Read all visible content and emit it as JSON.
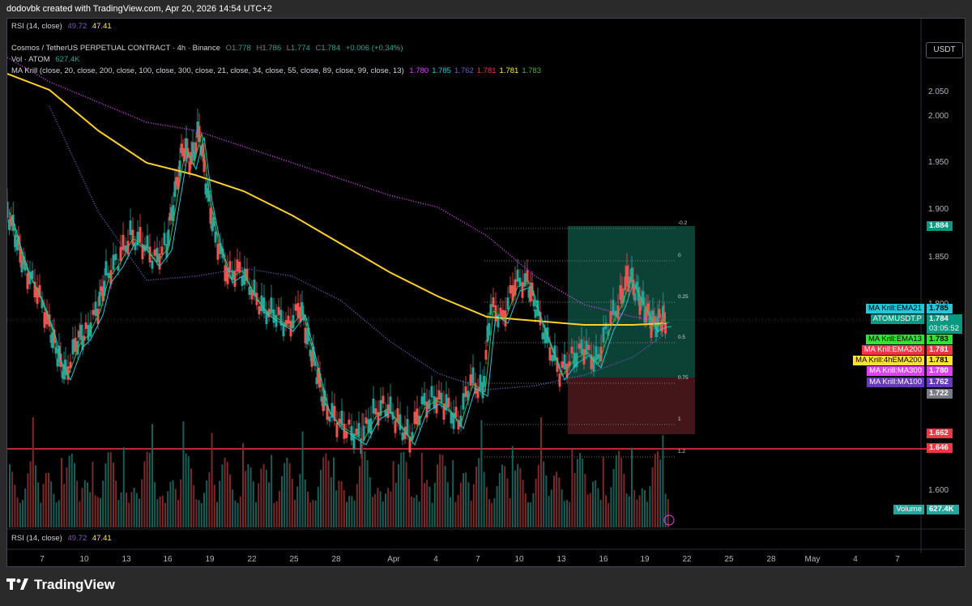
{
  "header": {
    "credit": "dodovbk created with TradingView.com, Apr 20, 2026 14:54 UTC+2"
  },
  "rsi_top": {
    "label": "RSI (14, close)",
    "v1": "49.72",
    "v2": "47.41"
  },
  "rsi_bottom": {
    "label": "RSI (14, close)",
    "v1": "49.72",
    "v2": "47.41"
  },
  "symbol": {
    "name": "Cosmos / TetherUS PERPETUAL CONTRACT · 4h · Binance",
    "o_label": "O",
    "o": "1.778",
    "h_label": "H",
    "h": "1.786",
    "l_label": "L",
    "l": "1.774",
    "c_label": "C",
    "c": "1.784",
    "change": "+0.006 (+0.34%)"
  },
  "volume_legend": {
    "label": "Vol · ATOM",
    "value": "627.4K"
  },
  "ma_legend": {
    "label": "MA Krill (close, 20, close, 200, close, 100, close, 300, close, 21, close, 34, close, 55, close, 89, close, 99, close, 13)",
    "values": [
      "1.780",
      "1.785",
      "1.762",
      "1.781",
      "1.781",
      "1.783"
    ],
    "colors": [
      "#e040fb",
      "#26c6da",
      "#7e57c2",
      "#f23645",
      "#ffeb3b",
      "#4caf50"
    ]
  },
  "currency_button": "USDT",
  "price_axis": [
    "2.050",
    "2.000",
    "1.950",
    "1.900",
    "1.850",
    "1.800",
    "1.600"
  ],
  "time_axis": [
    "7",
    "10",
    "13",
    "16",
    "19",
    "22",
    "25",
    "28",
    "Apr",
    "4",
    "7",
    "10",
    "13",
    "16",
    "19",
    "22",
    "25",
    "28",
    "May",
    "4",
    "7"
  ],
  "right_tags": [
    {
      "name": "MA Krill:EMA21",
      "value": "1.785",
      "bg": "#26c6da"
    },
    {
      "name": "ATOMUSDT.P",
      "value": "1.784",
      "sub": "03:05:52",
      "bg": "#089981"
    },
    {
      "name": "MA Krill:EMA13",
      "value": "1.783",
      "bg": "#2fe62f"
    },
    {
      "name": "MA Krill:EMA200",
      "value": "1.781",
      "bg": "#f23645"
    },
    {
      "name": "MA Krill:4hEMA200",
      "value": "1.781",
      "bg": "#ffe234"
    },
    {
      "name": "MA Krill:MA300",
      "value": "1.780",
      "bg": "#e040fb"
    },
    {
      "name": "MA Krill:MA100",
      "value": "1.762",
      "bg": "#673ab7"
    }
  ],
  "level_tags": [
    {
      "value": "1.884",
      "bg": "#089981"
    },
    {
      "value": "1.722",
      "bg": "#787b86"
    },
    {
      "value": "1.662",
      "bg": "#f23645"
    },
    {
      "value": "1.646",
      "bg": "#f23645"
    }
  ],
  "volume_tag": {
    "name": "Volume",
    "value": "627.4K"
  },
  "fib_levels": [
    "-0.2",
    "0",
    "0.25",
    "0.5",
    "0.75",
    "1",
    "1.2"
  ],
  "brand": {
    "name": "TradingView"
  }
}
